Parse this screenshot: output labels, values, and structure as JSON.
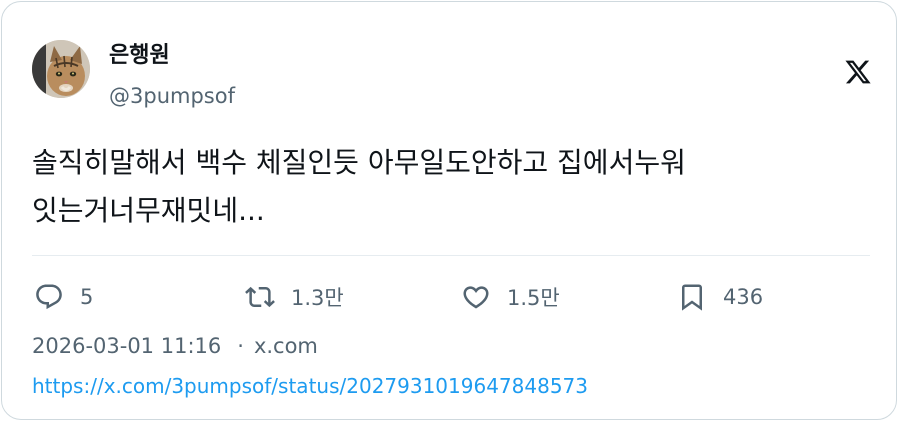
{
  "author": {
    "display_name": "은행원",
    "handle": "@3pumpsof",
    "avatar_icon": "cat-avatar"
  },
  "brand": {
    "logo_icon": "x-logo-icon"
  },
  "tweet": {
    "text": "솔직히말해서 백수 체질인듯 아무일도안하고 집에서누워\n잇는거너무재밋네..."
  },
  "actions": {
    "reply": {
      "icon": "reply-icon",
      "count": "5"
    },
    "repost": {
      "icon": "repost-icon",
      "count": "1.3만"
    },
    "like": {
      "icon": "heart-icon",
      "count": "1.5만"
    },
    "bookmark": {
      "icon": "bookmark-icon",
      "count": "436"
    }
  },
  "meta": {
    "timestamp": "2026-03-01 11:16",
    "separator": "·",
    "source": "x.com"
  },
  "link": {
    "url": "https://x.com/3pumpsof/status/2027931019647848573"
  },
  "colors": {
    "text": "#0f1419",
    "secondary": "#536471",
    "link": "#1d9bf0",
    "border": "#cfd9de"
  }
}
